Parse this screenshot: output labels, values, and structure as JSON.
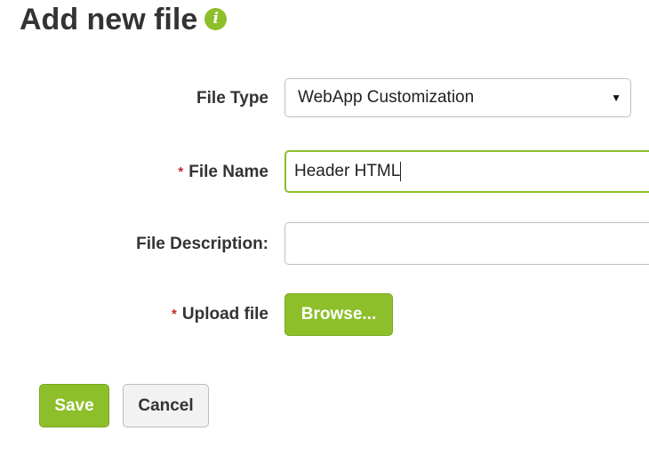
{
  "page": {
    "title": "Add new file",
    "info_icon_glyph": "i"
  },
  "form": {
    "file_type": {
      "label": "File Type",
      "selected": "WebApp Customization"
    },
    "file_name": {
      "required_mark": "*",
      "label": "File Name",
      "value": "Header HTML"
    },
    "file_description": {
      "label": "File Description:",
      "value": ""
    },
    "upload_file": {
      "required_mark": "*",
      "label": "Upload file",
      "browse_label": "Browse..."
    }
  },
  "actions": {
    "save_label": "Save",
    "cancel_label": "Cancel"
  },
  "colors": {
    "accent": "#8dbf2a",
    "required": "#cc2222"
  }
}
